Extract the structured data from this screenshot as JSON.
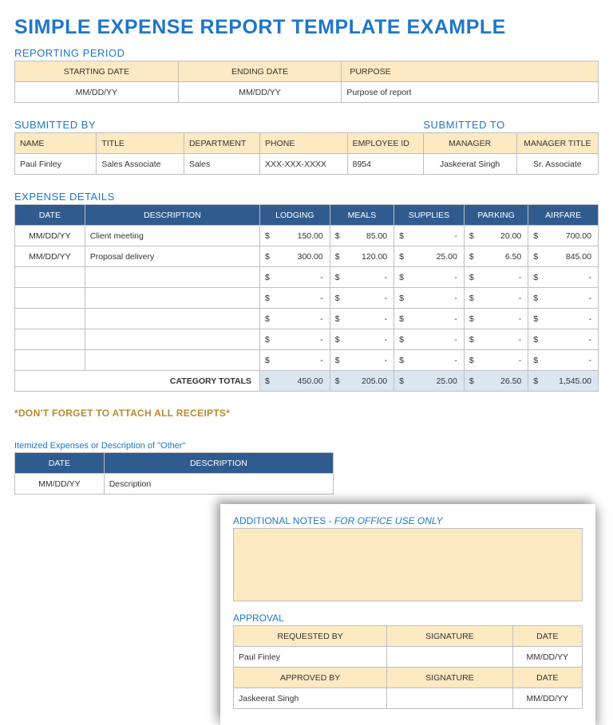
{
  "title": "SIMPLE EXPENSE REPORT TEMPLATE EXAMPLE",
  "sections": {
    "reporting_period": {
      "title": "REPORTING PERIOD",
      "headers": {
        "start": "STARTING DATE",
        "end": "ENDING DATE",
        "purpose": "PURPOSE"
      },
      "values": {
        "start": "MM/DD/YY",
        "end": "MM/DD/YY",
        "purpose": "Purpose of report"
      }
    },
    "submitted_by": {
      "title": "SUBMITTED BY",
      "title_to": "SUBMITTED TO",
      "headers": {
        "name": "NAME",
        "title": "TITLE",
        "dept": "DEPARTMENT",
        "phone": "PHONE",
        "emp": "EMPLOYEE ID",
        "mgr": "MANAGER",
        "mgr_title": "MANAGER TITLE"
      },
      "values": {
        "name": "Paul Finley",
        "title": "Sales Associate",
        "dept": "Sales",
        "phone": "XXX-XXX-XXXX",
        "emp": "8954",
        "mgr": "Jaskeerat Singh",
        "mgr_title": "Sr. Associate"
      }
    },
    "expense_details": {
      "title": "EXPENSE DETAILS",
      "headers": {
        "date": "DATE",
        "desc": "DESCRIPTION",
        "lodging": "LODGING",
        "meals": "MEALS",
        "supplies": "SUPPLIES",
        "parking": "PARKING",
        "airfare": "AIRFARE"
      },
      "rows": [
        {
          "date": "MM/DD/YY",
          "desc": "Client meeting",
          "lodging": "150.00",
          "meals": "85.00",
          "supplies": "-",
          "parking": "20.00",
          "airfare": "700.00"
        },
        {
          "date": "MM/DD/YY",
          "desc": "Proposal delivery",
          "lodging": "300.00",
          "meals": "120.00",
          "supplies": "25.00",
          "parking": "6.50",
          "airfare": "845.00"
        },
        {
          "date": "",
          "desc": "",
          "lodging": "-",
          "meals": "-",
          "supplies": "-",
          "parking": "-",
          "airfare": "-"
        },
        {
          "date": "",
          "desc": "",
          "lodging": "-",
          "meals": "-",
          "supplies": "-",
          "parking": "-",
          "airfare": "-"
        },
        {
          "date": "",
          "desc": "",
          "lodging": "-",
          "meals": "-",
          "supplies": "-",
          "parking": "-",
          "airfare": "-"
        },
        {
          "date": "",
          "desc": "",
          "lodging": "-",
          "meals": "-",
          "supplies": "-",
          "parking": "-",
          "airfare": "-"
        },
        {
          "date": "",
          "desc": "",
          "lodging": "-",
          "meals": "-",
          "supplies": "-",
          "parking": "-",
          "airfare": "-"
        }
      ],
      "totals_label": "CATEGORY TOTALS",
      "totals": {
        "lodging": "450.00",
        "meals": "205.00",
        "supplies": "25.00",
        "parking": "26.50",
        "airfare": "1,545.00"
      }
    },
    "receipts_note": "*DON'T FORGET TO ATTACH ALL RECEIPTS*",
    "itemized": {
      "title": "Itemized Expenses or Description of \"Other\"",
      "headers": {
        "date": "DATE",
        "desc": "DESCRIPTION"
      },
      "row": {
        "date": "MM/DD/YY",
        "desc": "Description"
      }
    }
  },
  "overlay": {
    "notes_title_a": "ADDITIONAL NOTES - ",
    "notes_title_b": "FOR OFFICE USE ONLY",
    "approval_title": "APPROVAL",
    "headers": {
      "req": "REQUESTED BY",
      "sig": "SIGNATURE",
      "date": "DATE",
      "appr": "APPROVED BY"
    },
    "requested_by": "Paul Finley",
    "approved_by": "Jaskeerat Singh",
    "date_ph": "MM/DD/YY"
  }
}
